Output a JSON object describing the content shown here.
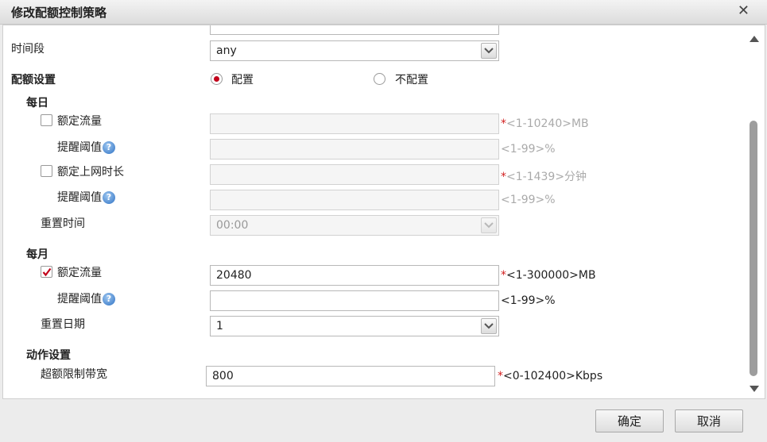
{
  "dialog": {
    "title": "修改配额控制策略",
    "close_icon": "close-icon"
  },
  "form": {
    "time_period": {
      "label": "时间段",
      "value": "any"
    },
    "quota_setting": {
      "label": "配额设置",
      "options": [
        {
          "label": "配置",
          "selected": true
        },
        {
          "label": "不配置",
          "selected": false
        }
      ]
    },
    "daily": {
      "label": "每日",
      "traffic": {
        "label": "额定流量",
        "checked": false,
        "value": "",
        "required": "*",
        "hint": "<1-10240>MB"
      },
      "traffic_threshold": {
        "label": "提醒阈值",
        "value": "",
        "hint": "<1-99>%"
      },
      "online_duration": {
        "label": "额定上网时长",
        "checked": false,
        "value": "",
        "required": "*",
        "hint": "<1-1439>分钟"
      },
      "duration_threshold": {
        "label": "提醒阈值",
        "value": "",
        "hint": "<1-99>%"
      },
      "reset_time": {
        "label": "重置时间",
        "value": "00:00"
      }
    },
    "monthly": {
      "label": "每月",
      "traffic": {
        "label": "额定流量",
        "checked": true,
        "value": "20480",
        "required": "*",
        "hint": "<1-300000>MB"
      },
      "traffic_threshold": {
        "label": "提醒阈值",
        "value": "",
        "hint": "<1-99>%"
      },
      "reset_date": {
        "label": "重置日期",
        "value": "1"
      }
    },
    "action": {
      "label": "动作设置",
      "bandwidth_limit": {
        "label": "超额限制带宽",
        "value": "800",
        "required": "*",
        "hint": "<0-102400>Kbps"
      }
    },
    "help_icon_glyph": "?"
  },
  "footer": {
    "confirm_label": "确定",
    "cancel_label": "取消"
  },
  "colors": {
    "accent_red": "#c2001a",
    "required_red": "#d21f1f",
    "help_blue": "#2f72c4"
  }
}
